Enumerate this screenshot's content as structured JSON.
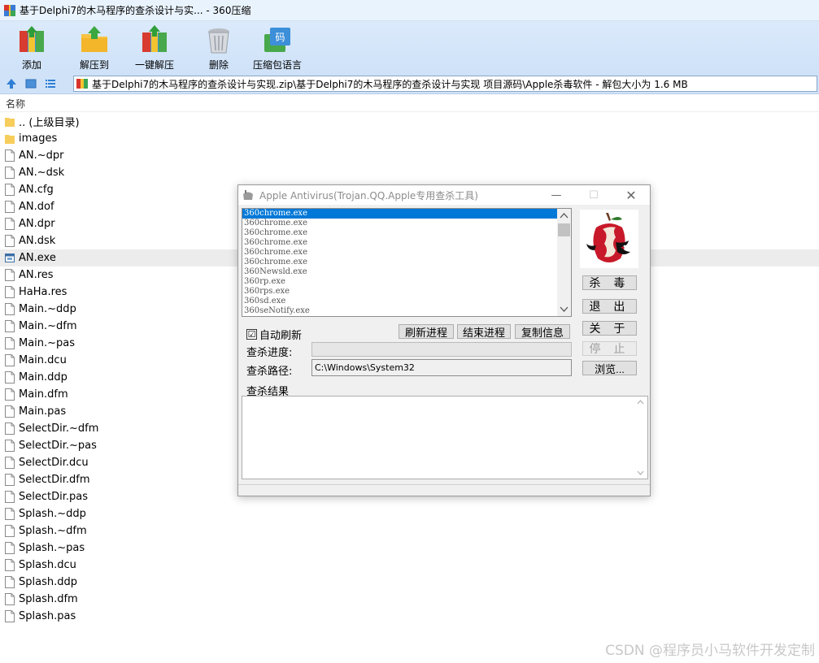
{
  "window": {
    "title": "基于Delphi7的木马程序的查杀设计与实... - 360压缩"
  },
  "toolbar": {
    "buttons": [
      {
        "label": "添加",
        "icon": "add-archive-icon"
      },
      {
        "label": "解压到",
        "icon": "extract-to-icon"
      },
      {
        "label": "一键解压",
        "icon": "one-click-extract-icon"
      },
      {
        "label": "删除",
        "icon": "delete-icon"
      },
      {
        "label": "压缩包语言",
        "icon": "archive-language-icon"
      }
    ]
  },
  "address": {
    "path": "基于Delphi7的木马程序的查杀设计与实现.zip\\基于Delphi7的木马程序的查杀设计与实现 项目源码\\Apple杀毒软件 - 解包大小为 1.6 MB"
  },
  "list": {
    "header": "名称",
    "items": [
      {
        "name": ".. (上级目录)",
        "type": "folder"
      },
      {
        "name": "images",
        "type": "folder"
      },
      {
        "name": "AN.~dpr",
        "type": "file"
      },
      {
        "name": "AN.~dsk",
        "type": "file"
      },
      {
        "name": "AN.cfg",
        "type": "file"
      },
      {
        "name": "AN.dof",
        "type": "file"
      },
      {
        "name": "AN.dpr",
        "type": "file"
      },
      {
        "name": "AN.dsk",
        "type": "file"
      },
      {
        "name": "AN.exe",
        "type": "exe"
      },
      {
        "name": "AN.res",
        "type": "file"
      },
      {
        "name": "HaHa.res",
        "type": "file"
      },
      {
        "name": "Main.~ddp",
        "type": "file"
      },
      {
        "name": "Main.~dfm",
        "type": "file"
      },
      {
        "name": "Main.~pas",
        "type": "file"
      },
      {
        "name": "Main.dcu",
        "type": "file"
      },
      {
        "name": "Main.ddp",
        "type": "file"
      },
      {
        "name": "Main.dfm",
        "type": "file"
      },
      {
        "name": "Main.pas",
        "type": "file"
      },
      {
        "name": "SelectDir.~dfm",
        "type": "file"
      },
      {
        "name": "SelectDir.~pas",
        "type": "file"
      },
      {
        "name": "SelectDir.dcu",
        "type": "file"
      },
      {
        "name": "SelectDir.dfm",
        "type": "file"
      },
      {
        "name": "SelectDir.pas",
        "type": "file"
      },
      {
        "name": "Splash.~ddp",
        "type": "file"
      },
      {
        "name": "Splash.~dfm",
        "type": "file"
      },
      {
        "name": "Splash.~pas",
        "type": "file"
      },
      {
        "name": "Splash.dcu",
        "type": "file"
      },
      {
        "name": "Splash.ddp",
        "type": "file"
      },
      {
        "name": "Splash.dfm",
        "type": "file"
      },
      {
        "name": "Splash.pas",
        "type": "file"
      }
    ],
    "selected_index": 8
  },
  "dialog": {
    "title": "Apple Antivirus(Trojan.QQ.Apple专用查杀工具)",
    "processes": [
      "360chrome.exe",
      "360chrome.exe",
      "360chrome.exe",
      "360chrome.exe",
      "360chrome.exe",
      "360chrome.exe",
      "360Newsld.exe",
      "360rp.exe",
      "360rps.exe",
      "360sd.exe",
      "360seNotify.exe"
    ],
    "buttons": {
      "kill": "杀 毒",
      "exit": "退 出",
      "about": "关 于",
      "stop": "停 止",
      "browse": "浏览...",
      "refresh_proc": "刷新进程",
      "end_proc": "结束进程",
      "copy_info": "复制信息"
    },
    "auto_refresh_label": "自动刷新",
    "auto_refresh_checked": "☑",
    "progress_label": "查杀进度:",
    "path_label": "查杀路径:",
    "path_value": "C:\\Windows\\System32",
    "result_label": "查杀结果"
  },
  "watermark": "CSDN @程序员小马软件开发定制",
  "colors": {
    "selection": "#0078d7",
    "toolbar_bg": "#cfe2f8",
    "title_bg": "#e9f3fd"
  }
}
